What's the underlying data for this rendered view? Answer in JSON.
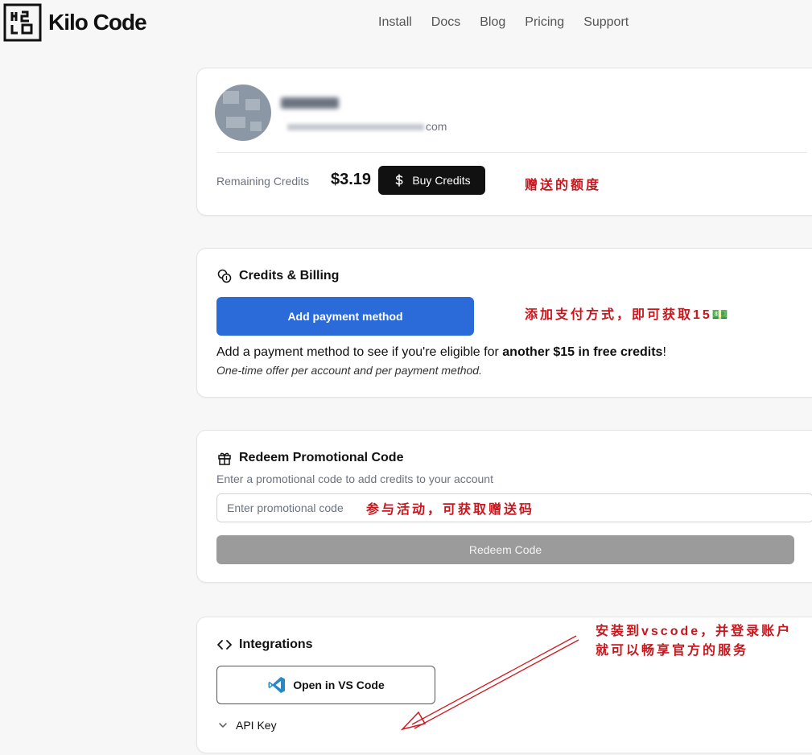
{
  "header": {
    "brand": "Kilo Code",
    "nav": [
      "Install",
      "Docs",
      "Blog",
      "Pricing",
      "Support"
    ]
  },
  "profile": {
    "email_suffix": "com",
    "credits_label": "Remaining Credits",
    "credits_value": "$3.19",
    "buy_button": "Buy Credits",
    "annotation": "赠送的额度"
  },
  "billing": {
    "title": "Credits & Billing",
    "add_payment_button": "Add payment method",
    "text_prefix": "Add a payment method to see if you're eligible for ",
    "text_bold": "another $15 in free credits",
    "text_suffix": "!",
    "note": "One-time offer per account and per payment method.",
    "annotation": "添加支付方式，即可获取15💵"
  },
  "promo": {
    "title": "Redeem Promotional Code",
    "description": "Enter a promotional code to add credits to your account",
    "input_placeholder": "Enter promotional code",
    "input_value": "",
    "redeem_button": "Redeem Code",
    "annotation": "参与活动，可获取赠送码"
  },
  "integrations": {
    "title": "Integrations",
    "vscode_button": "Open in VS Code",
    "api_key_label": "API Key",
    "annotation_line1": "安装到vscode，并登录账户",
    "annotation_line2": "就可以畅享官方的服务"
  },
  "colors": {
    "annotation_red": "#c8161d",
    "primary_blue": "#2a6ad9",
    "dark_button": "#111111",
    "disabled_button": "#9b9b9b",
    "vscode_blue": "#2489ca"
  },
  "icons": {
    "logo": "kilo-logo-icon",
    "buy": "dollar-icon",
    "billing": "coins-icon",
    "promo": "gift-icon",
    "integrations": "code-brackets-icon",
    "vscode": "vscode-icon",
    "api_key": "chevron-down-icon"
  }
}
